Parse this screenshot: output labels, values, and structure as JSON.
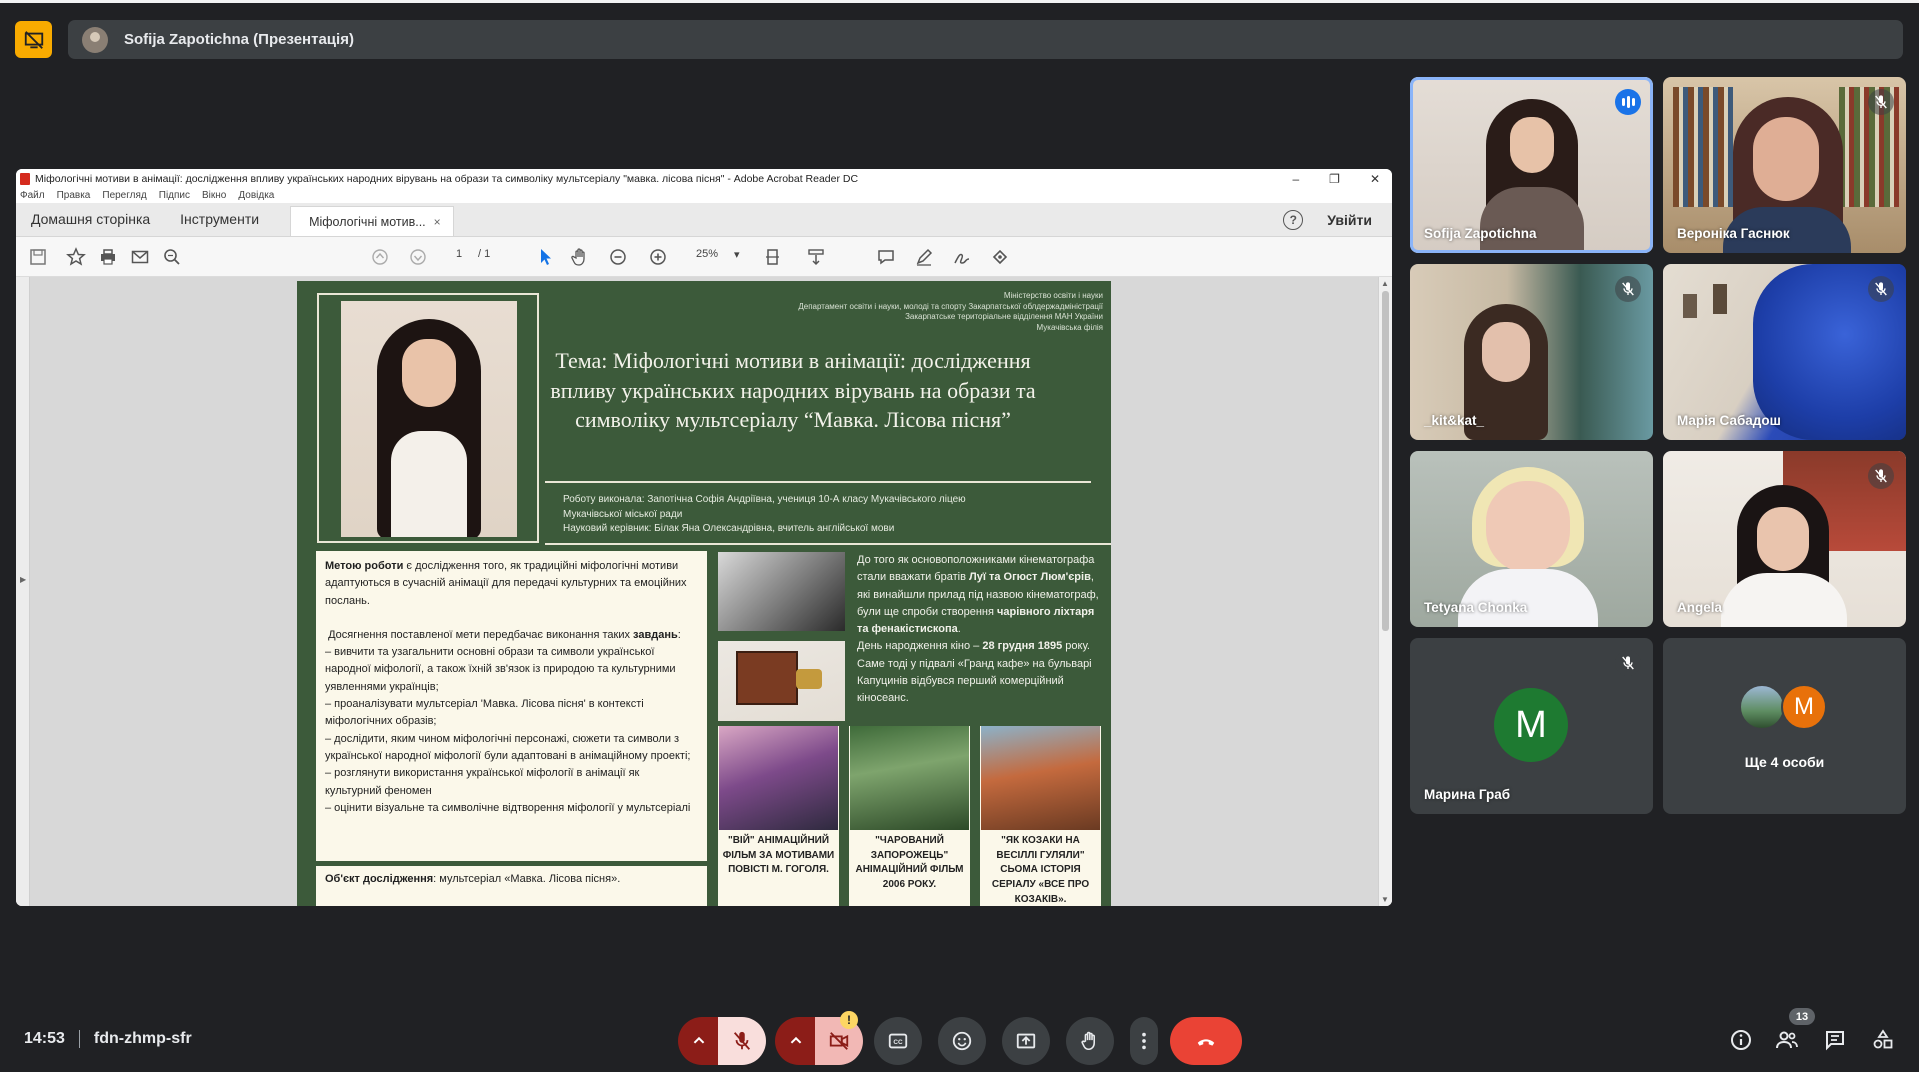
{
  "presentation": {
    "presenter_label": "Sofija Zapotichna (Презентація)"
  },
  "acrobat": {
    "window_title": "Міфологічні мотиви в анімації: дослідження впливу українських народних вірувань на образи та символіку мультсеріалу \"мавка. лісова пісня\" - Adobe Acrobat Reader DC",
    "menu": [
      "Файл",
      "Правка",
      "Перегляд",
      "Підпис",
      "Вікно",
      "Довідка"
    ],
    "tabs": {
      "home": "Домашня сторінка",
      "tools": "Інструменти",
      "doc": "Міфологічні мотив...",
      "doc_close": "×"
    },
    "sign_in": "Увійти",
    "page_current": "1",
    "page_total": "/  1",
    "zoom": "25%"
  },
  "poster": {
    "ministry": [
      "Міністерство освіти і науки",
      "Департамент освіти і науки, молоді та спорту Закарпатської облдержадміністрації",
      "Закарпатське територіальне відділення МАН України",
      "Мукачівська філія"
    ],
    "title": "Тема: Міфологічні мотиви в анімації: дослідження впливу українських народних вірувань на образи та символіку мультсеріалу “Мавка. Лісова пісня”",
    "authors": [
      "Роботу виконала: Запотічна Софія Андріївна, учениця 10-А класу Мукачівського ліцею",
      "Мукачівської міської ради",
      "Науковий керівник: Білак Яна Олександрівна, вчитель англійської мови"
    ],
    "aim_bold": "Метою роботи",
    "aim_text": " є  дослідження того, як традиційні міфологічні мотиви адаптуються в сучасній анімації для передачі культурних та емоційних послань.",
    "tasks_intro": "Досягнення поставленої мети передбачає виконання таких",
    "tasks_bold": "завдань",
    "tasks": [
      "– вивчити та узагальнити основні образи та символи української народної міфології, а також їхній зв'язок із природою та культурними уявленнями українців;",
      "– проаналізувати мультсеріал 'Мавка. Лісова пісня' в контексті міфологічних образів;",
      "– дослідити, яким чином міфологічні персонажі, сюжети та символи з української народної міфології були адаптовані в анімаційному проекті;",
      "– розглянути використання української міфології в анімації як культурний феномен",
      "– оцінити візуальне та символічне відтворення міфології у мультсеріалі"
    ],
    "object_bold": "Об'єкт дослідження",
    "object_text": ": мультсеріал «Мавка. Лісова пісня».",
    "history": {
      "p1": "До того як основоположниками кінематографа стали вважати братів",
      "p1_bold": "Луї та Огюст Люм'єрів",
      "p1_rest": ", які винайшли прилад під назвою кінематограф, були ще спроби створення",
      "p1_bold2": "чарівного ліхтаря та фенакістископа",
      "p2": "День народження кіно –",
      "p2_bold": "28 грудня 1895",
      "p2_rest": "року. Саме тоді у підвалі «Гранд кафе» на бульварі Капуцинів відбувся перший комерційний кіносеанс."
    },
    "cartoons": [
      "\"ВІЙ\" АНІМАЦІЙНИЙ ФІЛЬМ ЗА МОТИВАМИ ПОВІСТІ М. ГОГОЛЯ.",
      "\"ЧАРОВАНИЙ ЗАПОРОЖЕЦЬ\" АНІМАЦІЙНИЙ ФІЛЬМ 2006 РОКУ.",
      "\"ЯК КОЗАКИ НА ВЕСІЛЛІ ГУЛЯЛИ\" СЬОМА ІСТОРІЯ СЕРІАЛУ «ВСЕ ПРО КОЗАКІВ»."
    ]
  },
  "participants": [
    {
      "name": "Sofija Zapotichna",
      "speaking": true
    },
    {
      "name": "Вероніка Гаснюк",
      "muted": true
    },
    {
      "name": "_kit&kat_",
      "muted": true
    },
    {
      "name": "Марія Сабадош",
      "muted": true
    },
    {
      "name": "Tetyana Chonka",
      "muted": false
    },
    {
      "name": "Angela",
      "muted": true
    },
    {
      "name": "Марина Граб",
      "initial": "M",
      "muted": true
    }
  ],
  "more_tile": {
    "label": "Ще 4 особи",
    "initial": "M"
  },
  "meeting": {
    "time": "14:53",
    "code": "fdn-zhmp-sfr",
    "people_count": "13"
  },
  "colors": {
    "accent": "#8ab4f8",
    "end_call": "#ea4335",
    "present_badge": "#f9ab00",
    "poster_green": "#3c5a3a"
  }
}
